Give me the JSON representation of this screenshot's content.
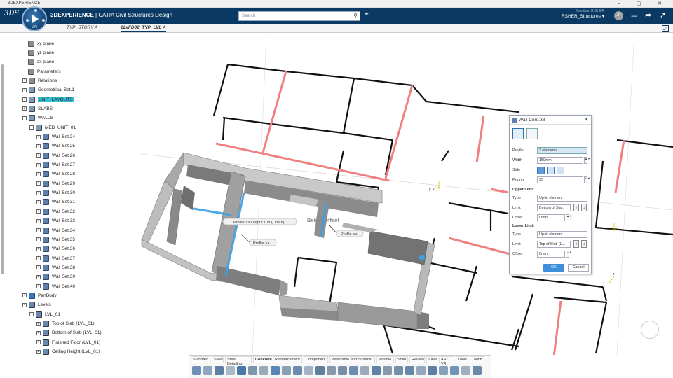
{
  "window": {
    "title": "3DEXPERIENCE",
    "min": "–",
    "max": "▢",
    "close": "✕"
  },
  "topbar": {
    "ds_logo": "3DS",
    "brand_bold": "3DEXPERIENCE",
    "brand_rest": " | CATIA Civil Structures Design",
    "search_placeholder": "Search",
    "user_name": "Jonathan RISHER",
    "user_project": "RSHER_Structures ▾",
    "avatar_initials": "JR",
    "compass_version": "V.R",
    "colors": {
      "bar": "#0a3a63",
      "accent": "#3d8fd9"
    }
  },
  "tabs": [
    {
      "label": "TYP_STORY A",
      "active": false
    },
    {
      "label": "22xFD02_TYP_LVL A",
      "active": true
    }
  ],
  "tab_add": "+",
  "tree": {
    "rows": [
      {
        "label": "xy plane",
        "icon": "plane-icon"
      },
      {
        "label": "yz plane",
        "icon": "plane-icon"
      },
      {
        "label": "zx plane",
        "icon": "plane-icon"
      },
      {
        "label": "Parameters",
        "icon": "parameters-icon"
      },
      {
        "label": "Relations",
        "icon": "relations-icon"
      },
      {
        "label": "Geometrical Set.1",
        "icon": "geoset-icon"
      },
      {
        "label": "UNIT_LAYOUTS",
        "icon": "geoset-icon",
        "highlight": true
      },
      {
        "label": "SLABS",
        "icon": "geoset-icon"
      },
      {
        "label": "WALLS",
        "icon": "geoset-icon"
      },
      {
        "label": "MED_UNIT_01",
        "icon": "geoset-icon"
      },
      {
        "label": "Wall Set.24",
        "icon": "wall-icon"
      },
      {
        "label": "Wall Set.25",
        "icon": "wall-icon"
      },
      {
        "label": "Wall Set.26",
        "icon": "wall-icon"
      },
      {
        "label": "Wall Set.27",
        "icon": "wall-icon"
      },
      {
        "label": "Wall Set.28",
        "icon": "wall-icon"
      },
      {
        "label": "Wall Set.29",
        "icon": "wall-icon"
      },
      {
        "label": "Wall Set.30",
        "icon": "wall-icon"
      },
      {
        "label": "Wall Set.31",
        "icon": "wall-icon"
      },
      {
        "label": "Wall Set.32",
        "icon": "wall-icon"
      },
      {
        "label": "Wall Set.33",
        "icon": "wall-icon"
      },
      {
        "label": "Wall Set.34",
        "icon": "wall-icon"
      },
      {
        "label": "Wall Set.35",
        "icon": "wall-icon"
      },
      {
        "label": "Wall Set.36",
        "icon": "wall-icon"
      },
      {
        "label": "Wall Set.37",
        "icon": "wall-icon"
      },
      {
        "label": "Wall Set.38",
        "icon": "wall-icon"
      },
      {
        "label": "Wall Set.39",
        "icon": "wall-icon"
      },
      {
        "label": "Wall Set.40",
        "icon": "wall-icon"
      },
      {
        "label": "PartBody",
        "icon": "partbody-icon"
      },
      {
        "label": "Levels",
        "icon": "levels-icon"
      },
      {
        "label": "LVL_01",
        "icon": "level-icon"
      },
      {
        "label": "Top of Slab (LVL_01)",
        "icon": "level-plane-icon"
      },
      {
        "label": "Bottom of Slab (LVL_01)",
        "icon": "level-plane-icon"
      },
      {
        "label": "Finished Floor (LVL_01)",
        "icon": "level-plane-icon"
      },
      {
        "label": "Ceiling Height (LVL_01)",
        "icon": "level-plane-icon"
      }
    ]
  },
  "viewport": {
    "labels": {
      "profile_output": "Profile >> Output.108 (Line.8)",
      "profile_1": "Profile >>",
      "profile_2": "Profile >>",
      "below_offset": "Below Offset",
      "axis_y": "y",
      "axis_x": "x",
      "axis_z": "z"
    },
    "colors": {
      "wall_grey": "#9b9b9b",
      "wall_dark": "#6e6e6e",
      "highlight_red": "#f08080",
      "selection_blue": "#3aa0e0"
    }
  },
  "dialog": {
    "title": "Wall Core.38",
    "close": "✕",
    "profile_label": "Profile",
    "profile_value": "3 elements",
    "width_label": "Width",
    "width_value": "150mm",
    "side_label": "Side",
    "priority_label": "Priority",
    "priority_value": "95",
    "upper_limit": "Upper Limit",
    "lower_limit": "Lower Limit",
    "upper_type_label": "Type",
    "upper_type_value": "Up-to element",
    "upper_limit_label": "Limit",
    "upper_limit_value": "Bottom of Sla...",
    "upper_offset_label": "Offset",
    "upper_offset_value": "0mm",
    "lower_type_label": "Type",
    "lower_type_value": "Up-to element",
    "lower_limit_label": "Limit",
    "lower_limit_value": "Top of Slab (L...",
    "lower_offset_label": "Offset",
    "lower_offset_value": "0mm",
    "ok": "OK",
    "cancel": "Cancel"
  },
  "actionbar": {
    "tabs": [
      "Standard",
      "Steel",
      "Steel Detailing",
      "Concrete",
      "Reinforcement",
      "Component",
      "Wireframe and Surface",
      "Volume",
      "Solid",
      "Review",
      "View",
      "AR-VR",
      "Tools",
      "Touch"
    ],
    "active_tab": "Concrete"
  }
}
